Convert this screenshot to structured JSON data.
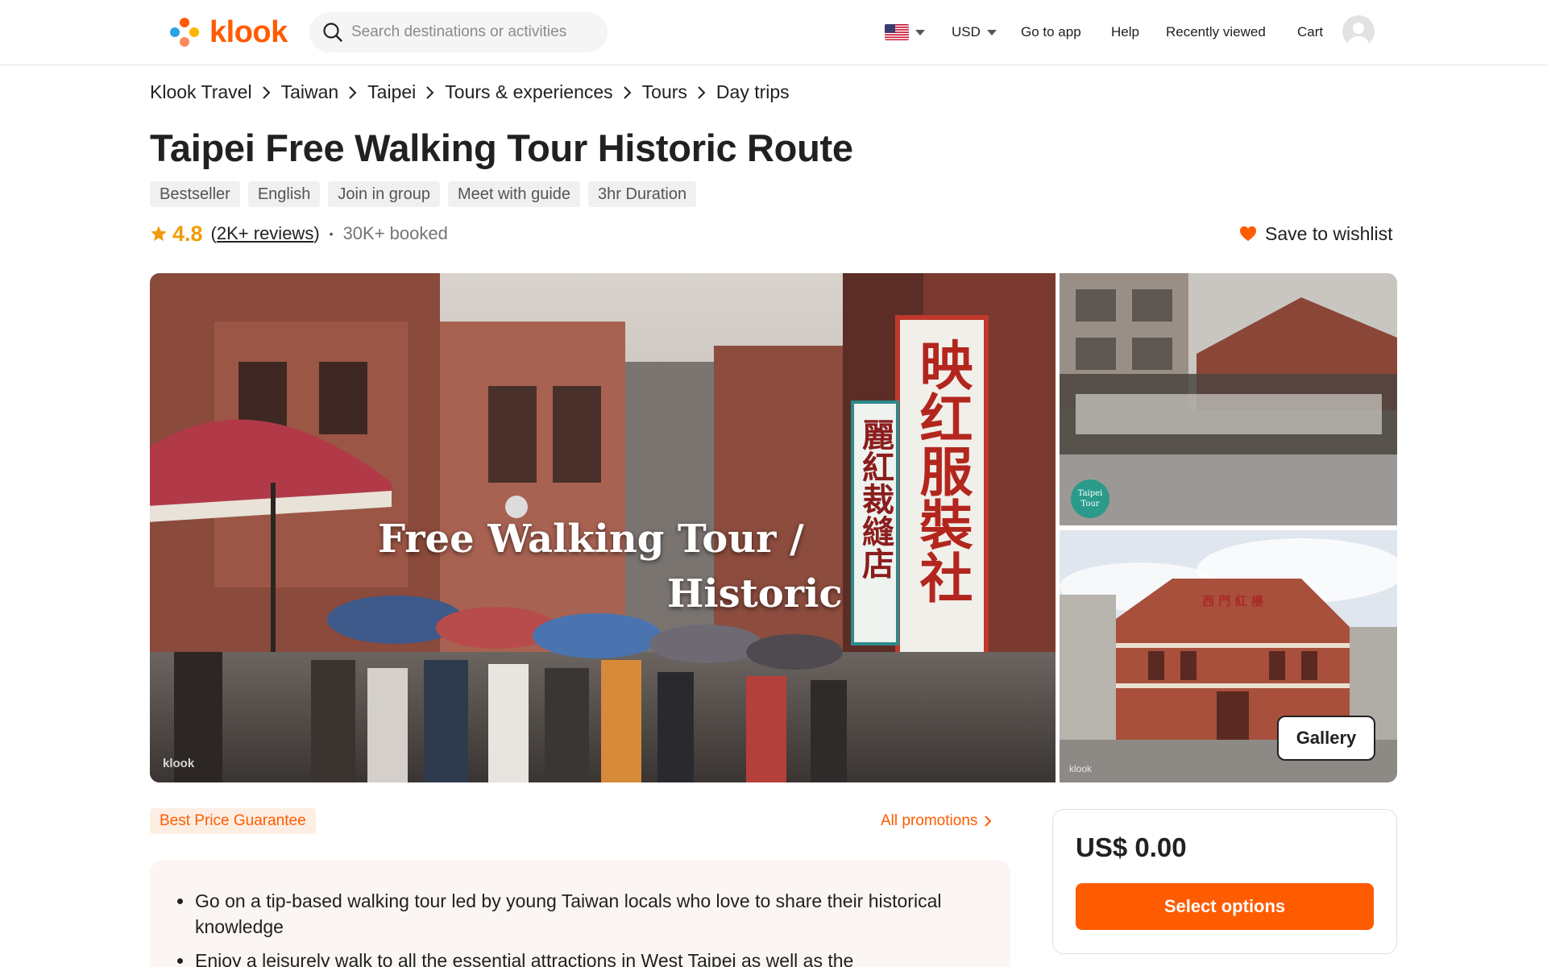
{
  "header": {
    "logo_text": "klook",
    "search_placeholder": "Search destinations or activities",
    "currency": "USD",
    "go_to_app": "Go to app",
    "help": "Help",
    "recently_viewed": "Recently viewed",
    "cart": "Cart"
  },
  "breadcrumb": [
    "Klook Travel",
    "Taiwan",
    "Taipei",
    "Tours & experiences",
    "Tours",
    "Day trips"
  ],
  "title": "Taipei Free Walking Tour Historic Route",
  "tags": [
    "Bestseller",
    "English",
    "Join in group",
    "Meet with guide",
    "3hr Duration"
  ],
  "rating": {
    "score": "4.8",
    "reviews_open": "(",
    "reviews_link": "2K+ reviews",
    "reviews_close": ")",
    "separator": "•",
    "booked": "30K+ booked"
  },
  "wishlist_label": "Save to wishlist",
  "gallery": {
    "main_overlay_line1": "Free Walking Tour /",
    "main_overlay_line2": "Historic",
    "sign_large": "映红服裝社",
    "sign_small": "麗紅裁縫店",
    "building_sign": "西 門 紅 樓",
    "watermark": "klook",
    "badge_text_1": "Taipei",
    "badge_text_2": "Tour",
    "button_label": "Gallery"
  },
  "promotions": {
    "best_price": "Best Price Guarantee",
    "all_promotions": "All promotions"
  },
  "highlights": [
    "Go on a tip-based walking tour led by young Taiwan locals who love to share their historical knowledge",
    "Enjoy a leisurely walk to all the essential attractions in West Taipei as well as the"
  ],
  "booking": {
    "price": "US$ 0.00",
    "select_label": "Select options"
  },
  "colors": {
    "brand": "#ff5b00",
    "star": "#f09b0a",
    "wishlist_heart": "#ff5b00"
  },
  "icons": [
    "search-icon",
    "flag-us-icon",
    "chevron-down-icon",
    "avatar-icon",
    "chevron-right-icon",
    "star-icon",
    "heart-icon"
  ]
}
